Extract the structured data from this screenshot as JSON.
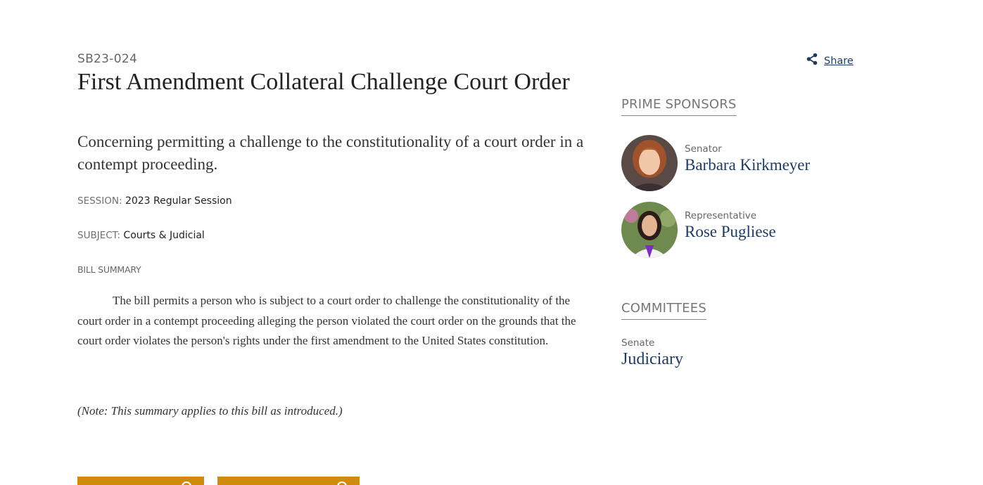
{
  "bill": {
    "id": "SB23-024",
    "title": "First Amendment Collateral Challenge Court Order",
    "subtitle": "Concerning permitting a challenge to the constitutionality of a court order in a contempt proceeding.",
    "session_label": "SESSION:",
    "session_value": "2023 Regular Session",
    "subject_label": "SUBJECT:",
    "subject_value": "Courts & Judicial",
    "summary_heading": "BILL SUMMARY",
    "summary_text": "The bill permits a person who is subject to a court order to challenge the constitutionality of the court order in a contempt proceeding alleging the person violated the court order on the grounds that the court order violates the person's rights under the first amendment to the United States constitution.",
    "summary_note": "(Note: This summary applies to this bill as introduced.)"
  },
  "share": {
    "label": "Share",
    "icon": "share-icon"
  },
  "prime_sponsors": {
    "heading": "PRIME SPONSORS",
    "sponsors": [
      {
        "role": "Senator",
        "name": "Barbara Kirkmeyer",
        "avatar": "avatar-photo"
      },
      {
        "role": "Representative",
        "name": "Rose Pugliese",
        "avatar": "avatar-photo"
      }
    ]
  },
  "committees": {
    "heading": "COMMITTEES",
    "items": [
      {
        "chamber": "Senate",
        "name": "Judiciary"
      }
    ]
  },
  "colors": {
    "link": "#1e3a5f",
    "button": "#d08a0e",
    "muted": "#666666"
  }
}
